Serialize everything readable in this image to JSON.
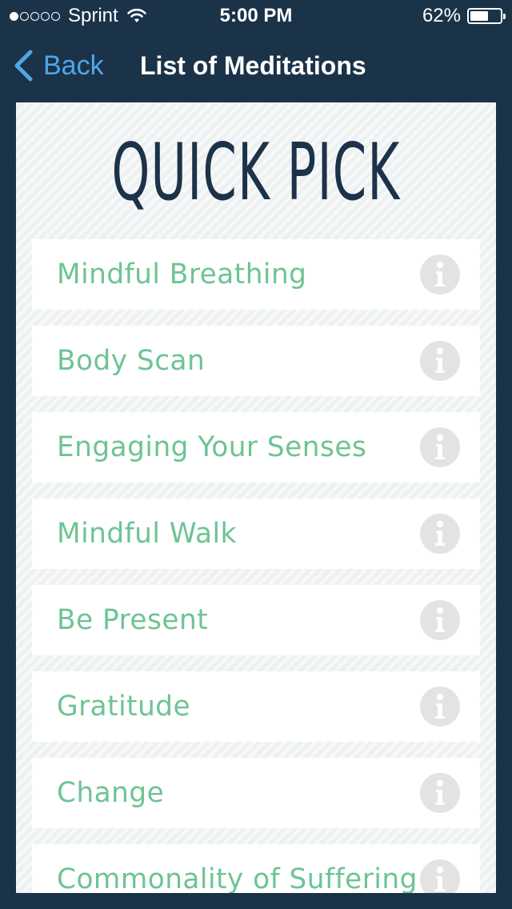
{
  "status_bar": {
    "carrier": "Sprint",
    "signal_dots_filled": 1,
    "signal_dots_total": 5,
    "time": "5:00 PM",
    "battery_percent": "62%",
    "battery_level": 0.62
  },
  "nav": {
    "back_label": "Back",
    "title": "List of Meditations"
  },
  "panel": {
    "title": "QUICK PICK"
  },
  "meditations": [
    {
      "label": "Mindful Breathing",
      "icon": "info-icon"
    },
    {
      "label": "Body Scan",
      "icon": "info-icon"
    },
    {
      "label": "Engaging Your Senses",
      "icon": "info-icon"
    },
    {
      "label": "Mindful Walk",
      "icon": "info-icon"
    },
    {
      "label": "Be Present",
      "icon": "info-icon"
    },
    {
      "label": "Gratitude",
      "icon": "info-icon"
    },
    {
      "label": "Change",
      "icon": "info-icon"
    },
    {
      "label": "Commonality of Suffering",
      "icon": "info-icon"
    }
  ],
  "colors": {
    "background": "#1b3349",
    "back_link": "#4fa6e8",
    "item_text": "#6dc493",
    "title_text": "#1c3249",
    "info_icon": "#e3e3e3"
  }
}
